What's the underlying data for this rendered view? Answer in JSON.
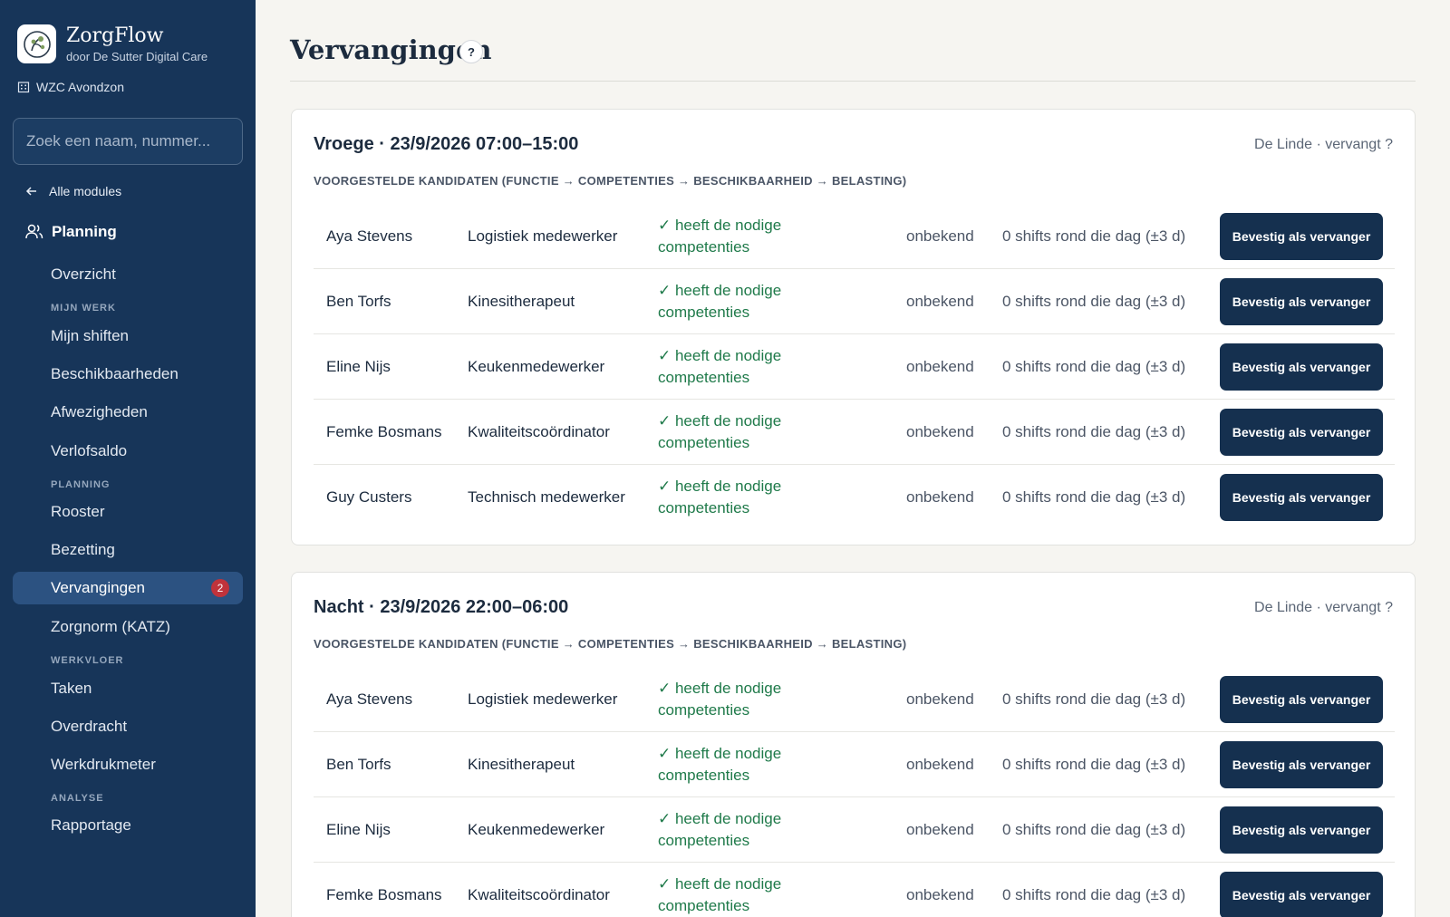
{
  "app": {
    "name": "ZorgFlow",
    "subtitle": "door De Sutter Digital Care",
    "facility": "WZC Avondzon",
    "logo_icon": "tree-logo-icon"
  },
  "sidebar": {
    "search_placeholder": "Zoek een naam, nummer...",
    "back_label": "Alle modules",
    "module_title": "Planning",
    "overview": "Overzicht",
    "sections": {
      "mijn_werk": "MIJN WERK",
      "planning": "PLANNING",
      "werkvloer": "WERKVLOER",
      "analyse": "ANALYSE"
    },
    "items": {
      "mijn_shiften": "Mijn shiften",
      "beschikbaarheden": "Beschikbaarheden",
      "afwezigheden": "Afwezigheden",
      "verlofsaldo": "Verlofsaldo",
      "rooster": "Rooster",
      "bezetting": "Bezetting",
      "vervangingen": "Vervangingen",
      "vervangingen_badge": "2",
      "zorgnorm": "Zorgnorm (KATZ)",
      "taken": "Taken",
      "overdracht": "Overdracht",
      "werkdrukmeter": "Werkdrukmeter",
      "rapportage": "Rapportage"
    }
  },
  "page": {
    "title": "Vervangingen",
    "help": "?"
  },
  "cards": [
    {
      "title": "Vroege · 23/9/2026 07:00–15:00",
      "meta": "De Linde · vervangt ?",
      "subtitle": "VOORGESTELDE KANDIDATEN (FUNCTIE → COMPETENTIES → BESCHIKBAARHEID → BELASTING)",
      "candidates": [
        {
          "name": "Aya Stevens",
          "function": "Logistiek medewerker",
          "competence": "✓ heeft de nodige competenties",
          "availability": "onbekend",
          "load": "0 shifts rond die dag (±3 d)",
          "action": "Bevestig als vervanger"
        },
        {
          "name": "Ben Torfs",
          "function": "Kinesitherapeut",
          "competence": "✓ heeft de nodige competenties",
          "availability": "onbekend",
          "load": "0 shifts rond die dag (±3 d)",
          "action": "Bevestig als vervanger"
        },
        {
          "name": "Eline Nijs",
          "function": "Keukenmedewerker",
          "competence": "✓ heeft de nodige competenties",
          "availability": "onbekend",
          "load": "0 shifts rond die dag (±3 d)",
          "action": "Bevestig als vervanger"
        },
        {
          "name": "Femke Bosmans",
          "function": "Kwaliteitscoördinator",
          "competence": "✓ heeft de nodige competenties",
          "availability": "onbekend",
          "load": "0 shifts rond die dag (±3 d)",
          "action": "Bevestig als vervanger"
        },
        {
          "name": "Guy Custers",
          "function": "Technisch medewerker",
          "competence": "✓ heeft de nodige competenties",
          "availability": "onbekend",
          "load": "0 shifts rond die dag (±3 d)",
          "action": "Bevestig als vervanger"
        }
      ]
    },
    {
      "title": "Nacht · 23/9/2026 22:00–06:00",
      "meta": "De Linde · vervangt ?",
      "subtitle": "VOORGESTELDE KANDIDATEN (FUNCTIE → COMPETENTIES → BESCHIKBAARHEID → BELASTING)",
      "candidates": [
        {
          "name": "Aya Stevens",
          "function": "Logistiek medewerker",
          "competence": "✓ heeft de nodige competenties",
          "availability": "onbekend",
          "load": "0 shifts rond die dag (±3 d)",
          "action": "Bevestig als vervanger"
        },
        {
          "name": "Ben Torfs",
          "function": "Kinesitherapeut",
          "competence": "✓ heeft de nodige competenties",
          "availability": "onbekend",
          "load": "0 shifts rond die dag (±3 d)",
          "action": "Bevestig als vervanger"
        },
        {
          "name": "Eline Nijs",
          "function": "Keukenmedewerker",
          "competence": "✓ heeft de nodige competenties",
          "availability": "onbekend",
          "load": "0 shifts rond die dag (±3 d)",
          "action": "Bevestig als vervanger"
        },
        {
          "name": "Femke Bosmans",
          "function": "Kwaliteitscoördinator",
          "competence": "✓ heeft de nodige competenties",
          "availability": "onbekend",
          "load": "0 shifts rond die dag (±3 d)",
          "action": "Bevestig als vervanger"
        }
      ]
    }
  ]
}
